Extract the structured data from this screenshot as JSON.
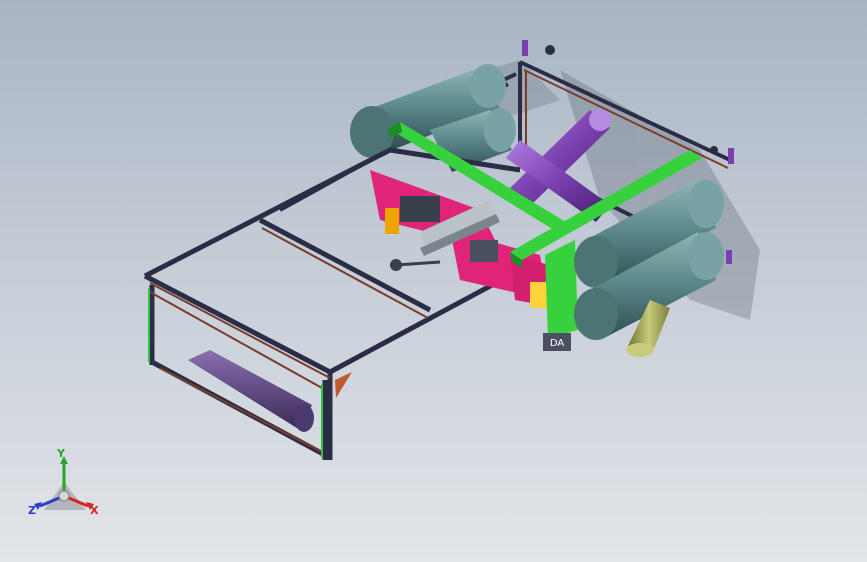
{
  "viewport": {
    "background_top": "#a9b5c4",
    "background_bottom": "#e2e5e9"
  },
  "model": {
    "part_label": "DA"
  },
  "colors": {
    "frame": "#2a2d45",
    "frame_rust": "#7a3d2a",
    "green_beam": "#36d13c",
    "magenta_plate": "#e0247a",
    "teal_roller": "#5e8b8c",
    "purple_shaft": "#7b3fb0",
    "olive_cylinder": "#a7ad5a"
  },
  "triad": {
    "x_label": "X",
    "y_label": "Y",
    "z_label": "Z",
    "x_color": "#d22626",
    "y_color": "#2aa52a",
    "z_color": "#2b3ec8"
  }
}
